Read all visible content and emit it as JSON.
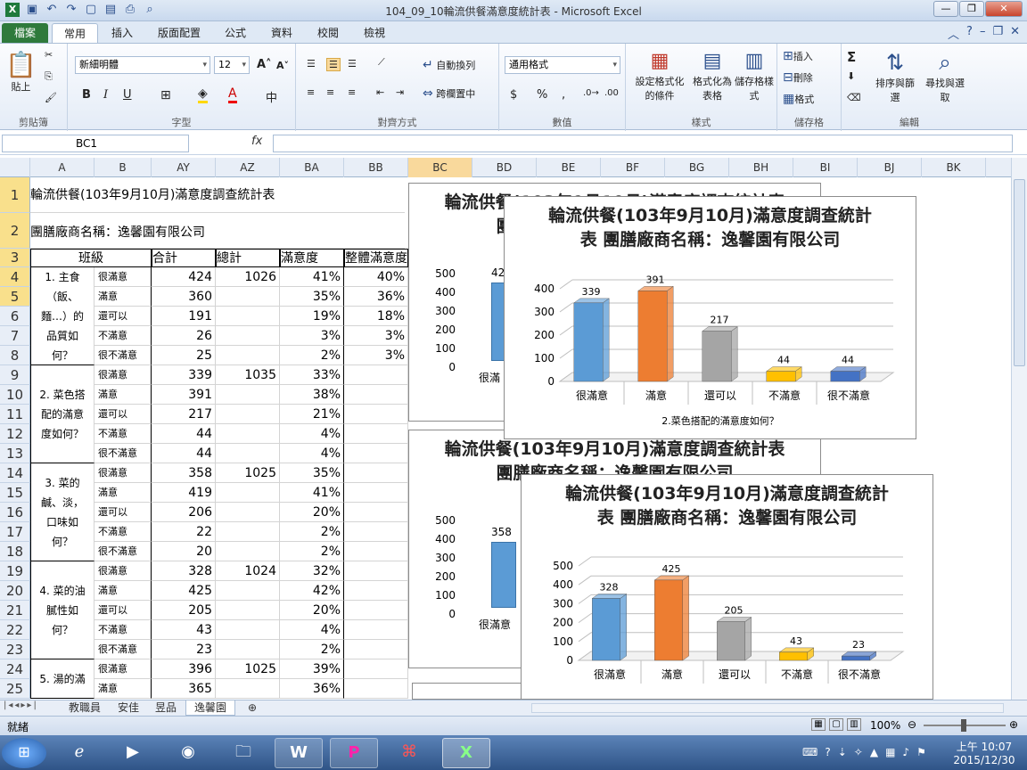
{
  "window": {
    "title": "104_09_10輪流供餐滿意度統計表 - Microsoft Excel",
    "controls": [
      "—",
      "❐",
      "✕"
    ]
  },
  "ribbon_tabs": [
    "檔案",
    "常用",
    "插入",
    "版面配置",
    "公式",
    "資料",
    "校閱",
    "檢視"
  ],
  "ribbon": {
    "clipboard": {
      "paste": "貼上",
      "group": "剪貼簿"
    },
    "font": {
      "name": "新細明體",
      "size": "12",
      "group": "字型",
      "bold": "B",
      "italic": "I",
      "underline": "U"
    },
    "alignment": {
      "wrap": "自動換列",
      "merge": "跨欄置中",
      "group": "對齊方式"
    },
    "number": {
      "format": "通用格式",
      "group": "數值",
      "currency": "$",
      "percent": "%",
      "comma": ","
    },
    "styles": {
      "cond": "設定格式化的條件",
      "table": "格式化為表格",
      "cell": "儲存格樣式",
      "group": "樣式"
    },
    "cells": {
      "insert": "插入",
      "delete": "刪除",
      "format": "格式",
      "group": "儲存格"
    },
    "editing": {
      "sort": "排序與篩選",
      "find": "尋找與選取",
      "group": "編輯",
      "sum": "Σ"
    }
  },
  "formula_bar": {
    "name_box": "BC1",
    "fx": "fx",
    "formula": ""
  },
  "columns": [
    "A",
    "B",
    "AY",
    "AZ",
    "BA",
    "BB",
    "BC",
    "BD",
    "BE",
    "BF",
    "BG",
    "BH",
    "BI",
    "BJ",
    "BK"
  ],
  "rows": [
    "1",
    "2",
    "3",
    "4",
    "5",
    "6",
    "7",
    "8",
    "9",
    "10",
    "11",
    "12",
    "13",
    "14",
    "15",
    "16",
    "17",
    "18",
    "19",
    "20",
    "21",
    "22",
    "23",
    "24",
    "25"
  ],
  "sheet": {
    "title": "輪流供餐(103年9月10月)滿意度調查統計表",
    "vendor": "團膳廠商名稱：逸馨園有限公司",
    "headers": {
      "class": "班級",
      "total": "合計",
      "grand": "總計",
      "sat": "滿意度",
      "overall": "整體滿意度"
    },
    "questions": [
      {
        "q": "1. 主食（飯、麵…）的品質如何？",
        "grand": "1026",
        "counts": [
          "424",
          "360",
          "191",
          "26",
          "25"
        ],
        "pcts": [
          "41%",
          "35%",
          "19%",
          "3%",
          "2%"
        ],
        "overall": [
          "40%",
          "36%",
          "18%",
          "3%",
          "3%"
        ]
      },
      {
        "q": "2. 菜色搭配的滿意度如何？",
        "grand": "1035",
        "counts": [
          "339",
          "391",
          "217",
          "44",
          "44"
        ],
        "pcts": [
          "33%",
          "38%",
          "21%",
          "4%",
          "4%"
        ],
        "overall": []
      },
      {
        "q": "3. 菜的鹹、淡，口味如何？",
        "grand": "1025",
        "counts": [
          "358",
          "419",
          "206",
          "22",
          "20"
        ],
        "pcts": [
          "35%",
          "41%",
          "20%",
          "2%",
          "2%"
        ],
        "overall": []
      },
      {
        "q": "4. 菜的油膩性如何？",
        "grand": "1024",
        "counts": [
          "328",
          "425",
          "205",
          "43",
          "23"
        ],
        "pcts": [
          "32%",
          "42%",
          "20%",
          "4%",
          "2%"
        ],
        "overall": []
      },
      {
        "q": "5. 湯的滿",
        "grand": "1025",
        "counts": [
          "396",
          "365"
        ],
        "pcts": [
          "39%",
          "36%"
        ],
        "overall": []
      }
    ],
    "levels": [
      "很滿意",
      "滿意",
      "還可以",
      "不滿意",
      "很不滿意"
    ]
  },
  "chart_data": [
    {
      "type": "bar",
      "title": "輪流供餐(103年9月10月)滿意度調查統計表 團膳廠商名稱：逸馨園有限公司",
      "categories": [
        "很滿意",
        "滿意",
        "還可以",
        "不滿意",
        "很不滿意"
      ],
      "values": [
        339,
        391,
        217,
        44,
        44
      ],
      "ylim": [
        0,
        400
      ],
      "yticks": [
        0,
        100,
        200,
        300,
        400
      ],
      "xlabel": "2.菜色搭配的滿意度如何？",
      "colors": [
        "#5b9bd5",
        "#ed7d31",
        "#a5a5a5",
        "#ffc000",
        "#4472c4"
      ]
    },
    {
      "type": "bar",
      "title": "輪流供餐(103年9月10月)滿意度調查統計表 團膳廠商名稱：逸馨園有限公司",
      "categories": [
        "很滿意",
        "滿意",
        "還可以",
        "不滿意",
        "很不滿意"
      ],
      "values": [
        328,
        425,
        205,
        43,
        23
      ],
      "ylim": [
        0,
        500
      ],
      "yticks": [
        0,
        100,
        200,
        300,
        400,
        500
      ],
      "xlabel": "",
      "colors": [
        "#5b9bd5",
        "#ed7d31",
        "#a5a5a5",
        "#ffc000",
        "#4472c4"
      ]
    }
  ],
  "behind_charts": [
    {
      "title": "輪流供餐(103年9月10月)滿意度調查統計表 團膳廠商名稱：逸馨園有限公司",
      "yticks": [
        "500",
        "400",
        "300",
        "200",
        "100",
        "0"
      ],
      "first_label": "42",
      "first_cat": "很滿"
    },
    {
      "title": "輪流供餐(103年9月10月)滿意度調查統計表 團膳廠商名稱：逸馨園有限公司",
      "yticks": [
        "500",
        "400",
        "300",
        "200",
        "100",
        "0"
      ],
      "first_label": "358",
      "first_cat": "很滿意"
    }
  ],
  "sheet_tabs": [
    "教職員",
    "安佳",
    "昱品",
    "逸馨園"
  ],
  "status": {
    "ready": "就緒",
    "zoom": "100%"
  },
  "clock": {
    "time": "上午 10:07",
    "date": "2015/12/30"
  }
}
